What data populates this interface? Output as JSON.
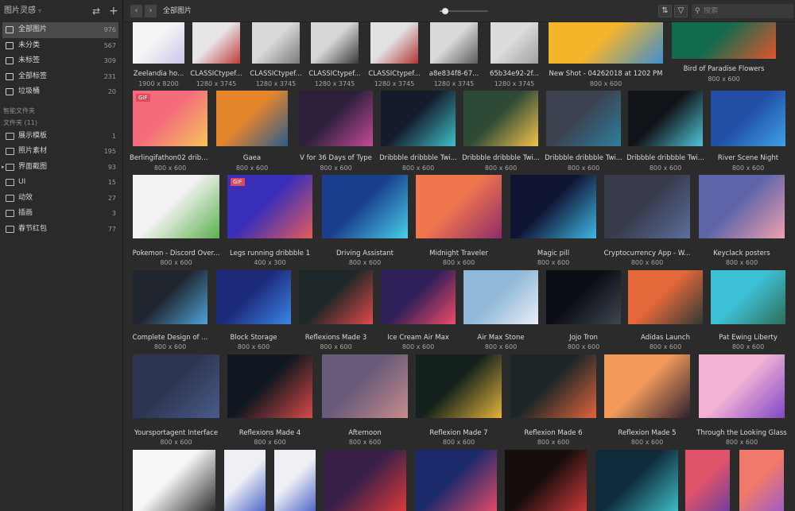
{
  "app": {
    "title": "图片灵感",
    "sync_icon": "swap-icon",
    "add_icon": "plus-icon"
  },
  "sidebar": {
    "items": [
      {
        "label": "全部图片",
        "count": "976",
        "icon": "images-icon",
        "active": true
      },
      {
        "label": "未分类",
        "count": "567",
        "icon": "uncategorized-icon",
        "active": false
      },
      {
        "label": "未标签",
        "count": "309",
        "icon": "untagged-icon",
        "active": false
      },
      {
        "label": "全部标签",
        "count": "231",
        "icon": "tags-icon",
        "active": false
      },
      {
        "label": "垃圾桶",
        "count": "20",
        "icon": "trash-icon",
        "active": false
      }
    ],
    "smart_folders_label": "智能文件夹",
    "folders_label": "文件夹 (11)",
    "folders": [
      {
        "label": "展示模板",
        "count": "1",
        "expandable": false
      },
      {
        "label": "照片素材",
        "count": "195",
        "expandable": false
      },
      {
        "label": "界面截图",
        "count": "93",
        "expandable": true
      },
      {
        "label": "UI",
        "count": "15",
        "expandable": false
      },
      {
        "label": "动效",
        "count": "27",
        "expandable": false
      },
      {
        "label": "插画",
        "count": "3",
        "expandable": false
      },
      {
        "label": "春节红包",
        "count": "77",
        "expandable": false
      }
    ]
  },
  "topbar": {
    "breadcrumb": "全部图片",
    "search_placeholder": "搜索",
    "zoom": 0.1,
    "sort_icon": "sort-icon",
    "filter_icon": "filter-icon",
    "back_icon": "chevron-left-icon",
    "forward_icon": "chevron-right-icon"
  },
  "grid": {
    "rows": [
      [
        {
          "name": "Zeelandia ho...",
          "dim": "1900 x 8200",
          "c1": "#f4f4f6",
          "c2": "#c9c6ea"
        },
        {
          "name": "CLASSICtypef...",
          "dim": "1280 x 3745",
          "c1": "#e7e5e7",
          "c2": "#c23a3a"
        },
        {
          "name": "CLASSICtypef...",
          "dim": "1280 x 3745",
          "c1": "#d9d9d9",
          "c2": "#7a7a7a"
        },
        {
          "name": "CLASSICtypef...",
          "dim": "1280 x 3745",
          "c1": "#d7d7d7",
          "c2": "#3a3a3a"
        },
        {
          "name": "CLASSICtypef...",
          "dim": "1280 x 3745",
          "c1": "#e2e2e2",
          "c2": "#b33434"
        },
        {
          "name": "a8e834f8-67...",
          "dim": "1280 x 3745",
          "c1": "#d9d9d9",
          "c2": "#5c5c5c"
        },
        {
          "name": "65b34e92-2f...",
          "dim": "1280 x 3745",
          "c1": "#dcdcdc",
          "c2": "#a0a0a0"
        },
        {
          "name": "New Shot - 04262018 at 1202 PM",
          "dim": "800 x 600",
          "c1": "#f5b52b",
          "c2": "#3d8ed1"
        },
        {
          "name": "Bird of Paradise Flowers",
          "dim": "800 x 600",
          "c1": "#136b4e",
          "c2": "#e2552d"
        }
      ],
      [
        {
          "name": "Berlingifathon02 dribb...",
          "dim": "800 x 600",
          "c1": "#f46c7c",
          "c2": "#f6c45a",
          "gif": "GIF"
        },
        {
          "name": "Gaea",
          "dim": "800 x 600",
          "c1": "#e6862c",
          "c2": "#2a5c8c"
        },
        {
          "name": "V for 36 Days of Type",
          "dim": "800 x 600",
          "c1": "#2b1f3a",
          "c2": "#c74a99"
        },
        {
          "name": "Dribbble dribbble Twi...",
          "dim": "800 x 600",
          "c1": "#141c2c",
          "c2": "#3ec0c9"
        },
        {
          "name": "Dribbble dribbble Twi...",
          "dim": "800 x 600",
          "c1": "#2d4a37",
          "c2": "#f2c24a"
        },
        {
          "name": "Dribbble dribbble Twi...",
          "dim": "800 x 600",
          "c1": "#3c4250",
          "c2": "#2d7e9e"
        },
        {
          "name": "Dribbble dribbble Twi...",
          "dim": "800 x 600",
          "c1": "#101317",
          "c2": "#4ec5d8"
        },
        {
          "name": "River Scene Night",
          "dim": "800 x 600",
          "c1": "#1f4ea3",
          "c2": "#3fa0e6"
        }
      ],
      [
        {
          "name": "Pokemon - Discord Over...",
          "dim": "800 x 600",
          "c1": "#f2f2f2",
          "c2": "#5bb04d"
        },
        {
          "name": "Legs running dribbble 1",
          "dim": "400 x 300",
          "c1": "#3a2fb8",
          "c2": "#e55b5b",
          "gif": "GIF"
        },
        {
          "name": "Driving Assistant",
          "dim": "800 x 600",
          "c1": "#1b3d8e",
          "c2": "#47d1e8"
        },
        {
          "name": "Midnight Traveler",
          "dim": "800 x 600",
          "c1": "#f1764e",
          "c2": "#8c2c6a"
        },
        {
          "name": "Magic pill",
          "dim": "800 x 600",
          "c1": "#0f1433",
          "c2": "#3fb8e6"
        },
        {
          "name": "Cryptocurrency App - W...",
          "dim": "800 x 600",
          "c1": "#363a4a",
          "c2": "#5c6e9c"
        },
        {
          "name": "Keyclack posters",
          "dim": "800 x 600",
          "c1": "#5d64a8",
          "c2": "#f0a0b0"
        }
      ],
      [
        {
          "name": "Complete Design of ...",
          "dim": "800 x 600",
          "c1": "#20252e",
          "c2": "#4ea3d9"
        },
        {
          "name": "Block Storage",
          "dim": "800 x 600",
          "c1": "#1c2a7a",
          "c2": "#3c86e8"
        },
        {
          "name": "Reflexions Made 3",
          "dim": "800 x 600",
          "c1": "#1d2628",
          "c2": "#e14a4a"
        },
        {
          "name": "Ice Cream Air Max",
          "dim": "800 x 600",
          "c1": "#2e1f58",
          "c2": "#f14a68"
        },
        {
          "name": "Air Max Stone",
          "dim": "800 x 600",
          "c1": "#8fb8d9",
          "c2": "#e9eef4"
        },
        {
          "name": "Jojo Tron",
          "dim": "800 x 600",
          "c1": "#0b0e14",
          "c2": "#3f4652"
        },
        {
          "name": "Adidas Launch",
          "dim": "800 x 600",
          "c1": "#e4683a",
          "c2": "#2f3a35"
        },
        {
          "name": "Pat Ewing Liberty",
          "dim": "800 x 600",
          "c1": "#3ec0d6",
          "c2": "#2b6f58"
        }
      ],
      [
        {
          "name": "Yoursportagent Interface",
          "dim": "800 x 600",
          "c1": "#2d3550",
          "c2": "#4a5b8a"
        },
        {
          "name": "Reflexions Made 4",
          "dim": "800 x 600",
          "c1": "#0f1820",
          "c2": "#d94848"
        },
        {
          "name": "Afternoon",
          "dim": "800 x 600",
          "c1": "#6a5b7a",
          "c2": "#c88c8c"
        },
        {
          "name": "Reflexion Made 7",
          "dim": "800 x 600",
          "c1": "#12211b",
          "c2": "#e3b43a"
        },
        {
          "name": "Reflexion Made 6",
          "dim": "800 x 600",
          "c1": "#1c2628",
          "c2": "#e2643c"
        },
        {
          "name": "Reflexion Made 5",
          "dim": "800 x 600",
          "c1": "#f19a5a",
          "c2": "#2f2030"
        },
        {
          "name": "Through the Looking Glass",
          "dim": "800 x 600",
          "c1": "#f4b3d6",
          "c2": "#7e47c8"
        }
      ],
      [
        {
          "name": "",
          "dim": "",
          "c1": "#f6f6f6",
          "c2": "#2a2a2a"
        },
        {
          "name": "",
          "dim": "",
          "c1": "#eef0f6",
          "c2": "#4a62c8"
        },
        {
          "name": "",
          "dim": "",
          "c1": "#eef0f6",
          "c2": "#4a62c8"
        },
        {
          "name": "",
          "dim": "",
          "c1": "#3a2048",
          "c2": "#e13a3a"
        },
        {
          "name": "",
          "dim": "",
          "c1": "#1b2a6a",
          "c2": "#e84a6a"
        },
        {
          "name": "",
          "dim": "",
          "c1": "#160d0d",
          "c2": "#d23a3a"
        },
        {
          "name": "",
          "dim": "",
          "c1": "#0f2a3a",
          "c2": "#3ec0c9"
        },
        {
          "name": "",
          "dim": "",
          "c1": "#e0546a",
          "c2": "#6a3fa0"
        },
        {
          "name": "",
          "dim": "",
          "c1": "#f07a6a",
          "c2": "#9c5cc8"
        }
      ]
    ]
  }
}
